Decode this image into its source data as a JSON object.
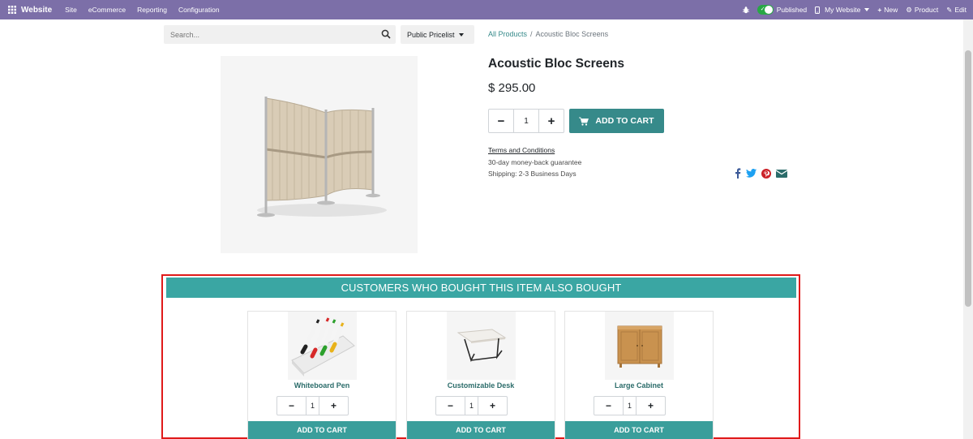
{
  "navbar": {
    "brand": "Website",
    "menu": [
      "Site",
      "eCommerce",
      "Reporting",
      "Configuration"
    ],
    "published": "Published",
    "my_website": "My Website",
    "new": "New",
    "product": "Product",
    "edit": "Edit"
  },
  "search": {
    "placeholder": "Search..."
  },
  "pricelist": {
    "label": "Public Pricelist"
  },
  "breadcrumb": {
    "all_products": "All Products",
    "separator": "/",
    "current": "Acoustic Bloc Screens"
  },
  "product": {
    "title": "Acoustic Bloc Screens",
    "price": "$ 295.00",
    "quantity": "1",
    "add_to_cart": "ADD TO CART",
    "terms": "Terms and Conditions",
    "guarantee": "30-day money-back guarantee",
    "shipping": "Shipping: 2-3 Business Days"
  },
  "related": {
    "header": "CUSTOMERS WHO BOUGHT THIS ITEM ALSO BOUGHT",
    "items": [
      {
        "name": "Whiteboard Pen",
        "quantity": "1",
        "add_to_cart": "ADD TO CART"
      },
      {
        "name": "Customizable Desk",
        "quantity": "1",
        "add_to_cart": "ADD TO CART"
      },
      {
        "name": "Large Cabinet",
        "quantity": "1",
        "add_to_cart": "ADD TO CART"
      }
    ]
  },
  "colors": {
    "navbar": "#7c6fa8",
    "accent": "#368a8a",
    "section_header": "#3aa6a3",
    "highlight_border": "#e01a1a"
  },
  "icons": {
    "apps": "grid-icon",
    "search": "search-icon",
    "cart": "cart-icon",
    "share": [
      "facebook-icon",
      "twitter-icon",
      "pinterest-icon",
      "email-icon"
    ]
  }
}
